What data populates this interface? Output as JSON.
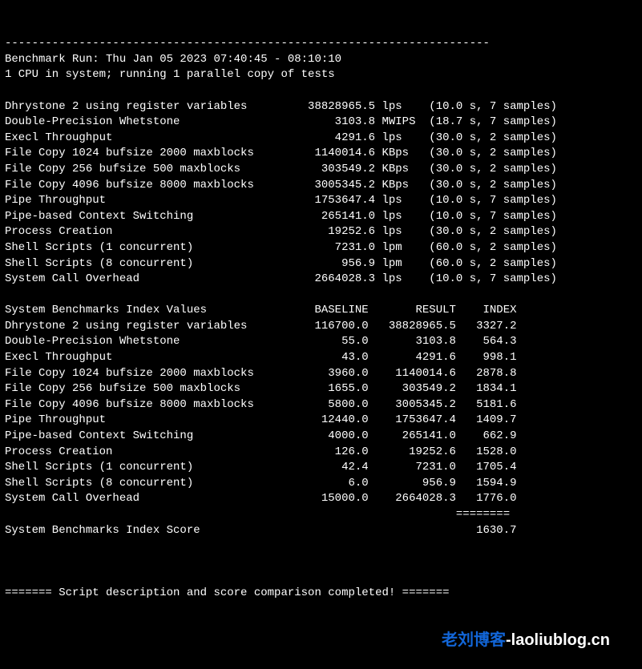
{
  "header": {
    "divider_top": "------------------------------------------------------------------------",
    "run_label": "Benchmark Run: Thu Jan 05 2023 07:40:45 - 08:10:10",
    "cpu_label": "1 CPU in system; running 1 parallel copy of tests"
  },
  "tests": [
    {
      "name": "Dhrystone 2 using register variables",
      "value": "38828965.5",
      "unit": "lps",
      "timing": "(10.0 s, 7 samples)"
    },
    {
      "name": "Double-Precision Whetstone",
      "value": "3103.8",
      "unit": "MWIPS",
      "timing": "(18.7 s, 7 samples)"
    },
    {
      "name": "Execl Throughput",
      "value": "4291.6",
      "unit": "lps",
      "timing": "(30.0 s, 2 samples)"
    },
    {
      "name": "File Copy 1024 bufsize 2000 maxblocks",
      "value": "1140014.6",
      "unit": "KBps",
      "timing": "(30.0 s, 2 samples)"
    },
    {
      "name": "File Copy 256 bufsize 500 maxblocks",
      "value": "303549.2",
      "unit": "KBps",
      "timing": "(30.0 s, 2 samples)"
    },
    {
      "name": "File Copy 4096 bufsize 8000 maxblocks",
      "value": "3005345.2",
      "unit": "KBps",
      "timing": "(30.0 s, 2 samples)"
    },
    {
      "name": "Pipe Throughput",
      "value": "1753647.4",
      "unit": "lps",
      "timing": "(10.0 s, 7 samples)"
    },
    {
      "name": "Pipe-based Context Switching",
      "value": "265141.0",
      "unit": "lps",
      "timing": "(10.0 s, 7 samples)"
    },
    {
      "name": "Process Creation",
      "value": "19252.6",
      "unit": "lps",
      "timing": "(30.0 s, 2 samples)"
    },
    {
      "name": "Shell Scripts (1 concurrent)",
      "value": "7231.0",
      "unit": "lpm",
      "timing": "(60.0 s, 2 samples)"
    },
    {
      "name": "Shell Scripts (8 concurrent)",
      "value": "956.9",
      "unit": "lpm",
      "timing": "(60.0 s, 2 samples)"
    },
    {
      "name": "System Call Overhead",
      "value": "2664028.3",
      "unit": "lps",
      "timing": "(10.0 s, 7 samples)"
    }
  ],
  "index_header": {
    "label": "System Benchmarks Index Values",
    "baseline": "BASELINE",
    "result": "RESULT",
    "index": "INDEX"
  },
  "index_rows": [
    {
      "name": "Dhrystone 2 using register variables",
      "baseline": "116700.0",
      "result": "38828965.5",
      "index": "3327.2"
    },
    {
      "name": "Double-Precision Whetstone",
      "baseline": "55.0",
      "result": "3103.8",
      "index": "564.3"
    },
    {
      "name": "Execl Throughput",
      "baseline": "43.0",
      "result": "4291.6",
      "index": "998.1"
    },
    {
      "name": "File Copy 1024 bufsize 2000 maxblocks",
      "baseline": "3960.0",
      "result": "1140014.6",
      "index": "2878.8"
    },
    {
      "name": "File Copy 256 bufsize 500 maxblocks",
      "baseline": "1655.0",
      "result": "303549.2",
      "index": "1834.1"
    },
    {
      "name": "File Copy 4096 bufsize 8000 maxblocks",
      "baseline": "5800.0",
      "result": "3005345.2",
      "index": "5181.6"
    },
    {
      "name": "Pipe Throughput",
      "baseline": "12440.0",
      "result": "1753647.4",
      "index": "1409.7"
    },
    {
      "name": "Pipe-based Context Switching",
      "baseline": "4000.0",
      "result": "265141.0",
      "index": "662.9"
    },
    {
      "name": "Process Creation",
      "baseline": "126.0",
      "result": "19252.6",
      "index": "1528.0"
    },
    {
      "name": "Shell Scripts (1 concurrent)",
      "baseline": "42.4",
      "result": "7231.0",
      "index": "1705.4"
    },
    {
      "name": "Shell Scripts (8 concurrent)",
      "baseline": "6.0",
      "result": "956.9",
      "index": "1594.9"
    },
    {
      "name": "System Call Overhead",
      "baseline": "15000.0",
      "result": "2664028.3",
      "index": "1776.0"
    }
  ],
  "score_divider": "                                                                   ========",
  "score": {
    "label": "System Benchmarks Index Score",
    "value": "1630.7"
  },
  "footer": "======= Script description and score comparison completed! =======",
  "watermark": {
    "zh": "老刘博客",
    "en": "-laoliublog.cn"
  }
}
